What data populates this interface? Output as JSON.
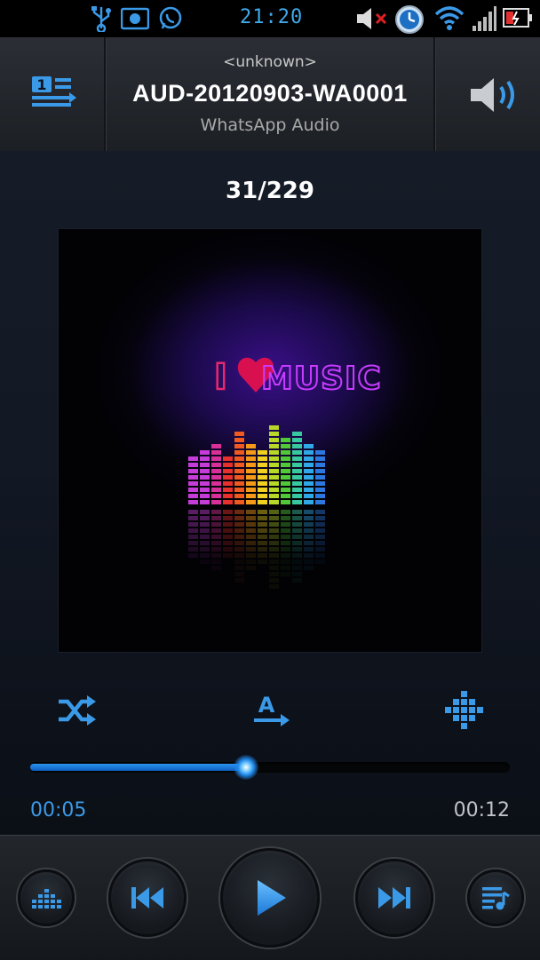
{
  "status_bar": {
    "time": "21:20",
    "icons": [
      "usb-icon",
      "gallery-icon",
      "whatsapp-icon",
      "speaker-muted-icon",
      "alarm-icon",
      "wifi-icon",
      "signal-icon",
      "battery-charging-icon"
    ]
  },
  "header": {
    "artist": "<unknown>",
    "title": "AUD-20120903-WA0001",
    "album": "WhatsApp Audio",
    "left_icon": "playlist-queue-icon",
    "right_icon": "volume-icon"
  },
  "track_counter": "31/229",
  "album_art": {
    "text_i": "I",
    "text_music": "MUSIC"
  },
  "controls": {
    "shuffle_icon": "shuffle-icon",
    "repeat_icon": "repeat-a-icon",
    "effects_icon": "sound-effects-icon"
  },
  "progress": {
    "current_time": "00:05",
    "total_time": "00:12",
    "fraction": 0.45
  },
  "bottom_bar": {
    "buttons": [
      "equalizer-icon",
      "previous-icon",
      "play-icon",
      "next-icon",
      "playlist-icon"
    ]
  },
  "colors": {
    "accent": "#3b9ae8",
    "background": "#0d121b"
  }
}
